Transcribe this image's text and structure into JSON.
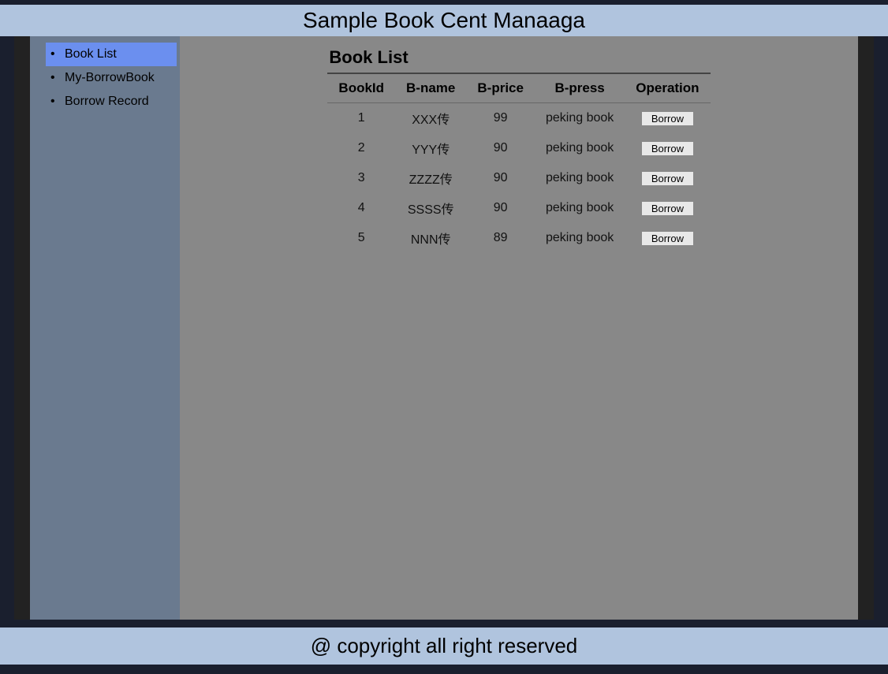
{
  "header": {
    "title": "Sample Book Cent Manaaga"
  },
  "sidebar": {
    "items": [
      {
        "label": "Book List",
        "active": true
      },
      {
        "label": "My-BorrowBook",
        "active": false
      },
      {
        "label": "Borrow Record",
        "active": false
      }
    ]
  },
  "main": {
    "table_caption": "Book List",
    "columns": [
      {
        "header": "BookId"
      },
      {
        "header": "B-name"
      },
      {
        "header": "B-price"
      },
      {
        "header": "B-press"
      },
      {
        "header": "Operation"
      }
    ],
    "rows": [
      {
        "id": "1",
        "name": "XXX传",
        "price": "99",
        "press": "peking book",
        "op_label": "Borrow"
      },
      {
        "id": "2",
        "name": "YYY传",
        "price": "90",
        "press": "peking book",
        "op_label": "Borrow"
      },
      {
        "id": "3",
        "name": "ZZZZ传",
        "price": "90",
        "press": "peking book",
        "op_label": "Borrow"
      },
      {
        "id": "4",
        "name": "SSSS传",
        "price": "90",
        "press": "peking book",
        "op_label": "Borrow"
      },
      {
        "id": "5",
        "name": "NNN传",
        "price": "89",
        "press": "peking book",
        "op_label": "Borrow"
      }
    ]
  },
  "footer": {
    "text": "@ copyright all right reserved"
  }
}
